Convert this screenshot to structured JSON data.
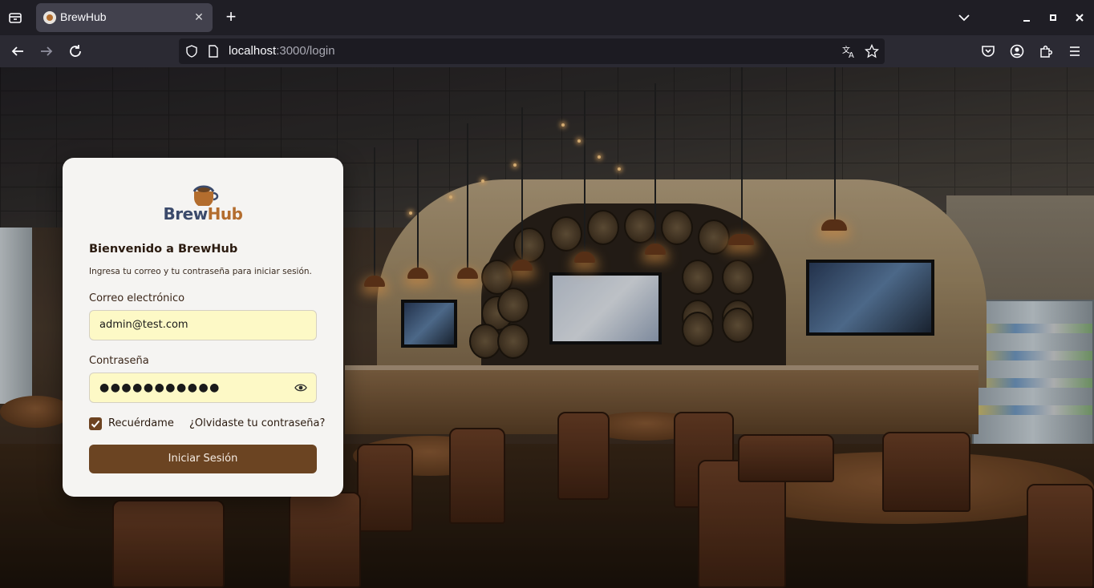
{
  "browser": {
    "tab": {
      "title": "BrewHub"
    },
    "url": {
      "host": "localhost",
      "path": ":3000/login"
    }
  },
  "login": {
    "logo": {
      "part1": "Brew",
      "part2": "Hub",
      "colors": {
        "brew": "#3b4a6b",
        "hub": "#b36d2e"
      }
    },
    "title": "Bienvenido a BrewHub",
    "subtitle": "Ingresa tu correo y tu contraseña para iniciar sesión.",
    "email": {
      "label": "Correo electrónico",
      "value": "admin@test.com"
    },
    "password": {
      "label": "Contraseña",
      "masked_value": "●●●●●●●●●●●"
    },
    "remember": {
      "label": "Recuérdame",
      "checked": true
    },
    "forgot_link": "¿Olvidaste tu contraseña?",
    "submit_label": "Iniciar Sesión",
    "accent_color": "#6b4422"
  }
}
